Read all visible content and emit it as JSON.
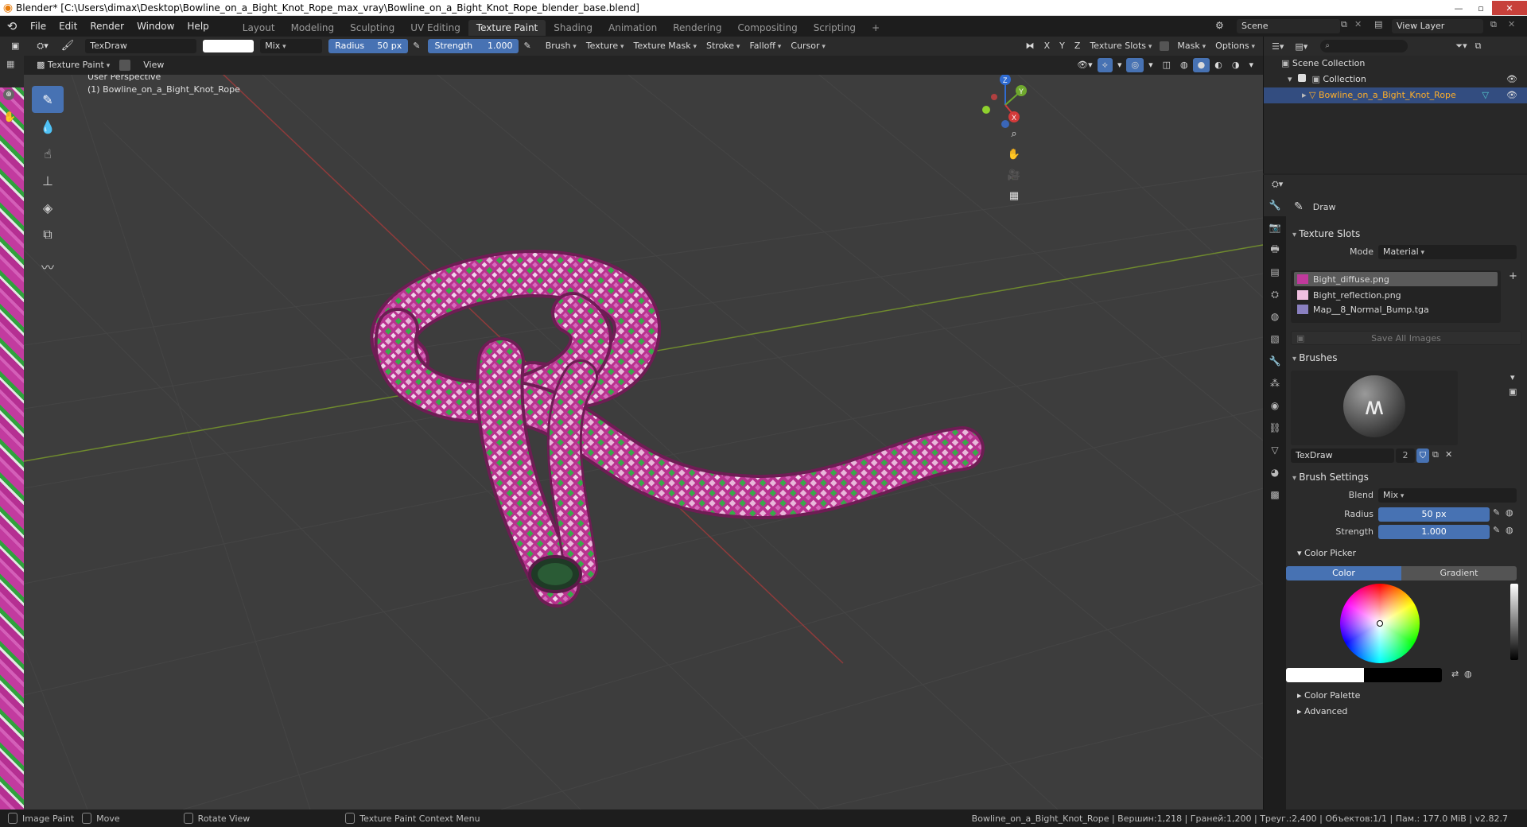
{
  "window": {
    "title": "Blender* [C:\\Users\\dimax\\Desktop\\Bowline_on_a_Bight_Knot_Rope_max_vray\\Bowline_on_a_Bight_Knot_Rope_blender_base.blend]",
    "min": "—",
    "max": "▫",
    "close": "✕"
  },
  "menu": [
    "File",
    "Edit",
    "Render",
    "Window",
    "Help"
  ],
  "workspaces": [
    "Layout",
    "Modeling",
    "Sculpting",
    "UV Editing",
    "Texture Paint",
    "Shading",
    "Animation",
    "Rendering",
    "Compositing",
    "Scripting",
    "+"
  ],
  "active_workspace": "Texture Paint",
  "scene": {
    "label": "Scene",
    "view_layer": "View Layer"
  },
  "toolheader": {
    "brush_name": "TexDraw",
    "blend": "Mix",
    "radius_label": "Radius",
    "radius_value": "50 px",
    "strength_label": "Strength",
    "strength_value": "1.000",
    "menus": [
      "Brush",
      "Texture",
      "Texture Mask",
      "Stroke",
      "Falloff",
      "Cursor"
    ],
    "axes": [
      "X",
      "Y",
      "Z"
    ],
    "right_menus": [
      "Texture Slots",
      "Mask",
      "Options"
    ]
  },
  "viewheader": {
    "mode": "Texture Paint",
    "view": "View"
  },
  "viewport": {
    "line1": "User Perspective",
    "line2": "(1) Bowline_on_a_Bight_Knot_Rope",
    "gizmo": {
      "x": "X",
      "y": "Y",
      "z": "Z"
    }
  },
  "outliner": {
    "scene_collection": "Scene Collection",
    "collection": "Collection",
    "object": "Bowline_on_a_Bight_Knot_Rope"
  },
  "properties": {
    "tool_name": "Draw",
    "texture_slots": {
      "title": "Texture Slots",
      "mode_label": "Mode",
      "mode_value": "Material",
      "slots": [
        "Bight_diffuse.png",
        "Bight_reflection.png",
        "Map__8_Normal_Bump.tga"
      ],
      "save_all": "Save All Images"
    },
    "brushes": {
      "title": "Brushes",
      "brush_name": "TexDraw",
      "users": "2"
    },
    "brush_settings": {
      "title": "Brush Settings",
      "blend_label": "Blend",
      "blend_value": "Mix",
      "radius_label": "Radius",
      "radius_value": "50 px",
      "strength_label": "Strength",
      "strength_value": "1.000",
      "color_picker": "Color Picker",
      "color_tab": "Color",
      "gradient_tab": "Gradient",
      "color_palette": "Color Palette",
      "advanced": "Advanced"
    }
  },
  "statusbar": {
    "items": [
      "Image Paint",
      "Move",
      "Rotate View",
      "Texture Paint Context Menu"
    ],
    "stats": "Bowline_on_a_Bight_Knot_Rope | Вершин:1,218 | Граней:1,200 | Треуг.:2,400 | Объектов:1/1 | Пам.: 177.0 MiB | v2.82.7"
  },
  "colors": {
    "accent": "#4772b3",
    "rope": "#c0399c",
    "rope_check_light": "#e6b3d6",
    "rope_check_green": "#3aa84a",
    "grid_x": "#9a3a3a",
    "grid_y": "#6a8a2a"
  }
}
